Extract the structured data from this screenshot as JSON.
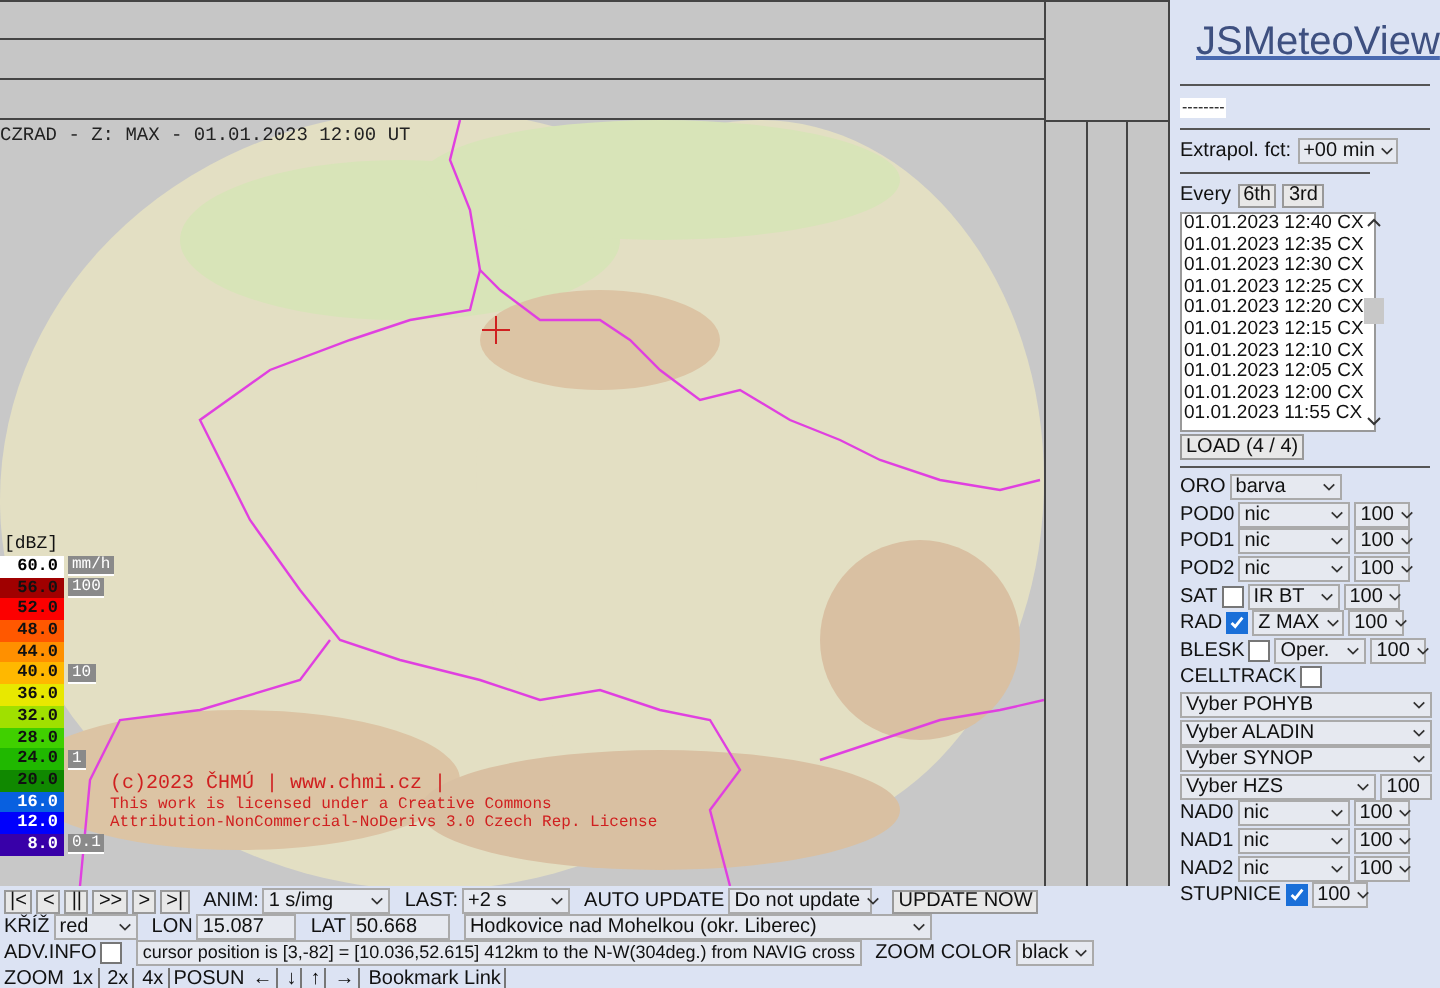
{
  "map": {
    "title": "CZRAD - Z: MAX - 01.01.2023 12:00 UT",
    "legend": {
      "unit": "[dBZ]",
      "items": [
        {
          "value": "60.0",
          "color": "#ffffff",
          "rain_label": "mm/h"
        },
        {
          "value": "56.0",
          "color": "#a00000",
          "rain_label": "100"
        },
        {
          "value": "52.0",
          "color": "#fc0000"
        },
        {
          "value": "48.0",
          "color": "#ff5800"
        },
        {
          "value": "44.0",
          "color": "#ff9000"
        },
        {
          "value": "40.0",
          "color": "#ffb800",
          "rain_label": "10"
        },
        {
          "value": "36.0",
          "color": "#e8e800"
        },
        {
          "value": "32.0",
          "color": "#a0e000"
        },
        {
          "value": "28.0",
          "color": "#40d000"
        },
        {
          "value": "24.0",
          "color": "#20b800",
          "rain_label": "1"
        },
        {
          "value": "20.0",
          "color": "#108800"
        },
        {
          "value": "16.0",
          "color": "#0860e0"
        },
        {
          "value": "12.0",
          "color": "#0000fc"
        },
        {
          "value": "8.0",
          "color": "#3800a8",
          "rain_label": "0.1"
        }
      ]
    },
    "copyright": [
      "(c)2023 ČHMÚ | www.chmi.cz |",
      "This work is licensed under a Creative Commons",
      "Attribution-NonCommercial-NoDerivs 3.0 Czech Rep. License"
    ]
  },
  "controls": {
    "nav_buttons": [
      "|<",
      "<",
      "||",
      ">>",
      ">",
      ">|"
    ],
    "anim": {
      "label": "ANIM:",
      "value": "1 s/img"
    },
    "last": {
      "label": "LAST:",
      "value": "+2 s"
    },
    "auto_update": {
      "label": "AUTO UPDATE",
      "value": "Do not update"
    },
    "update_button": "UPDATE NOW",
    "cross": {
      "label": "KŘÍŽ",
      "value": "red"
    },
    "lon": {
      "label": "LON",
      "value": "15.087"
    },
    "lat": {
      "label": "LAT",
      "value": "50.668"
    },
    "place": "Hodkovice nad Mohelkou (okr. Liberec)",
    "adv_info": {
      "label": "ADV.INFO",
      "checked": false
    },
    "cursor_info": "cursor position is [3,-82] = [10.036,52.615]  412km to the N-W(304deg.) from NAVIG cross",
    "zoom_color": {
      "label": "ZOOM COLOR",
      "value": "black"
    },
    "zoom": {
      "label": "ZOOM",
      "buttons": [
        "1x",
        "2x",
        "4x"
      ]
    },
    "pan": {
      "label": "POSUN",
      "buttons": [
        "←",
        "↓",
        "↑",
        "→"
      ]
    },
    "bookmark": "Bookmark Link"
  },
  "sidebar": {
    "logo": "JSMeteoView",
    "status": "--------",
    "extrapolation": {
      "label": "Extrapol. fct:",
      "value": "+00 min"
    },
    "every": {
      "label": "Every",
      "buttons": [
        "6th",
        "3rd"
      ]
    },
    "times": [
      "01.01.2023 12:40 CX",
      "01.01.2023 12:35 CX",
      "01.01.2023 12:30 CX",
      "01.01.2023 12:25 CX",
      "01.01.2023 12:20 CX",
      "01.01.2023 12:15 CX",
      "01.01.2023 12:10 CX",
      "01.01.2023 12:05 CX",
      "01.01.2023 12:00 CX",
      "01.01.2023 11:55 CX"
    ],
    "load_button": "LOAD (4 / 4)",
    "layers": [
      {
        "kind": "select",
        "label": "ORO",
        "value": "barva"
      },
      {
        "kind": "select",
        "label": "POD0",
        "value": "nic",
        "opacity": "100"
      },
      {
        "kind": "select",
        "label": "POD1",
        "value": "nic",
        "opacity": "100"
      },
      {
        "kind": "select",
        "label": "POD2",
        "value": "nic",
        "opacity": "100"
      },
      {
        "kind": "check",
        "label": "SAT",
        "checked": false,
        "value": "IR BT",
        "opacity": "100"
      },
      {
        "kind": "check",
        "label": "RAD",
        "checked": true,
        "value": "Z MAX",
        "opacity": "100"
      },
      {
        "kind": "check",
        "label": "BLESK",
        "checked": false,
        "value": "Oper.",
        "opacity": "100"
      },
      {
        "kind": "check",
        "label": "CELLTRACK",
        "checked": false
      },
      {
        "kind": "wide",
        "value": "Vyber POHYB"
      },
      {
        "kind": "wide",
        "value": "Vyber ALADIN"
      },
      {
        "kind": "wide",
        "value": "Vyber SYNOP"
      },
      {
        "kind": "wide",
        "value": "Vyber HZS",
        "opacity": "100"
      },
      {
        "kind": "select",
        "label": "NAD0",
        "value": "nic",
        "opacity": "100"
      },
      {
        "kind": "select",
        "label": "NAD1",
        "value": "nic",
        "opacity": "100"
      },
      {
        "kind": "select",
        "label": "NAD2",
        "value": "nic",
        "opacity": "100"
      },
      {
        "kind": "check",
        "label": "STUPNICE",
        "checked": true,
        "opacity": "100"
      }
    ]
  }
}
